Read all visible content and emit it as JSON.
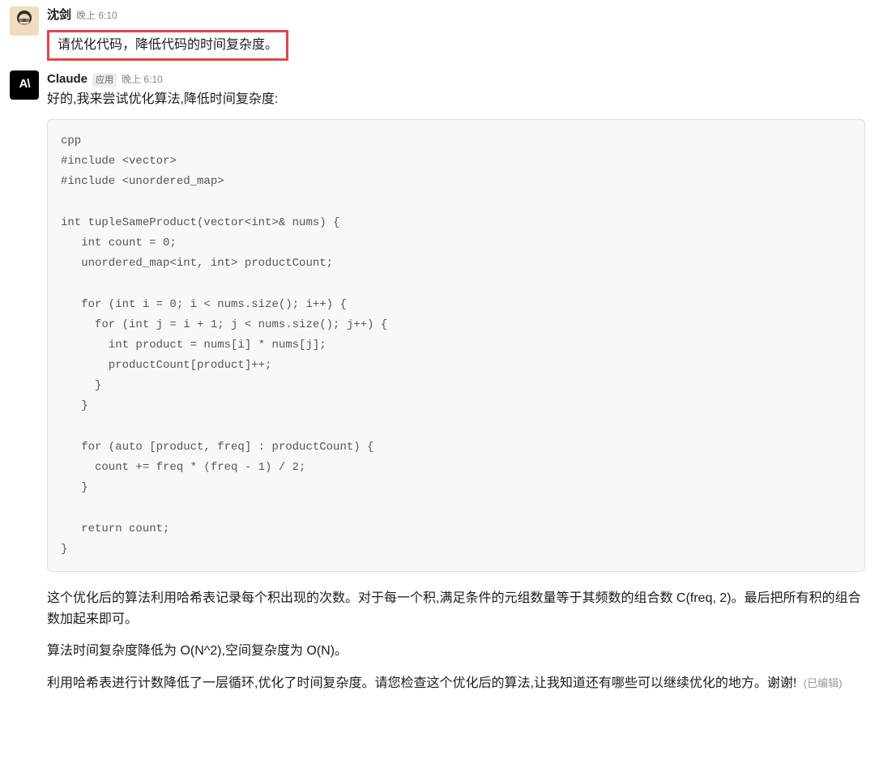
{
  "user_msg": {
    "name": "沈剑",
    "time": "晚上 6:10",
    "text": "请优化代码，降低代码的时间复杂度。"
  },
  "claude_msg": {
    "name": "Claude",
    "badge": "应用",
    "time": "晚上 6:10",
    "intro": "好的,我来尝试优化算法,降低时间复杂度:",
    "code": "cpp\n#include <vector>\n#include <unordered_map>\n\nint tupleSameProduct(vector<int>& nums) {\n   int count = 0;\n   unordered_map<int, int> productCount;\n\n   for (int i = 0; i < nums.size(); i++) {\n     for (int j = i + 1; j < nums.size(); j++) {\n       int product = nums[i] * nums[j];\n       productCount[product]++;\n     }\n   }\n\n   for (auto [product, freq] : productCount) {\n     count += freq * (freq - 1) / 2;\n   }\n\n   return count;\n}",
    "para1": "这个优化后的算法利用哈希表记录每个积出现的次数。对于每一个积,满足条件的元组数量等于其频数的组合数 C(freq, 2)。最后把所有积的组合数加起来即可。",
    "para2": "算法时间复杂度降低为 O(N^2),空间复杂度为 O(N)。",
    "para3": "利用哈希表进行计数降低了一层循环,优化了时间复杂度。请您检查这个优化后的算法,让我知道还有哪些可以继续优化的地方。谢谢!",
    "edited": "(已编辑)",
    "avatar_text": "A\\"
  }
}
